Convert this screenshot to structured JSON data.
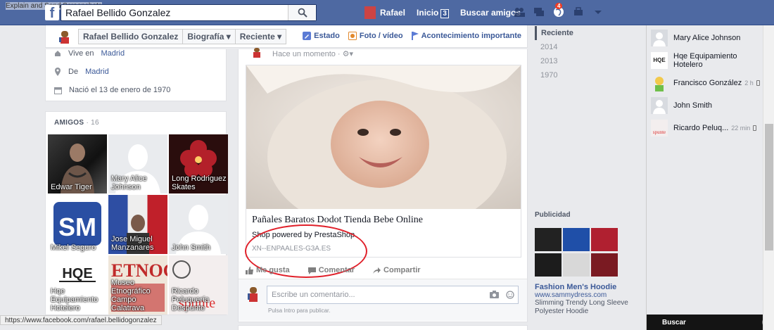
{
  "overlay": {
    "label": "Explain and Send Screenshots"
  },
  "search": {
    "value": "Rafael Bellido Gonzalez"
  },
  "nav": {
    "profile": "Rafael",
    "home": "Inicio",
    "home_count": "3",
    "find_friends": "Buscar amigos",
    "notif_count": "4"
  },
  "timeline_nav": {
    "crumbs": [
      "Rafael Bellido Gonzalez",
      "Biografía ▾",
      "Reciente ▾"
    ],
    "actions": [
      "Estado",
      "Foto / vídeo",
      "Acontecimiento importante"
    ]
  },
  "info": {
    "lives_prefix": "Vive en",
    "lives_place": "Madrid",
    "from_prefix": "De",
    "from_place": "Madrid",
    "born": "Nació el 13 de enero de 1970"
  },
  "friends": {
    "title": "AMIGOS",
    "count": "· 16",
    "items": [
      {
        "name": "Edwar Tiger"
      },
      {
        "name": "Mary Alice Johnson"
      },
      {
        "name": "Long Rodriguez Skates"
      },
      {
        "name": "Mikel Seguro"
      },
      {
        "name": "Jose Miguel Manzanares"
      },
      {
        "name": "John Smith"
      },
      {
        "name": "Hqe Equipamiento Hotelero"
      },
      {
        "name": "Museo Etnográfico Campo Calatrava"
      },
      {
        "name": "Ricardo Peluquería Despunte"
      }
    ]
  },
  "post": {
    "meta": "Hace un momento · ",
    "link_title": "Pañales Baratos Dodot Tienda Bebe Online",
    "link_desc": "Shop powered by PrestaShop",
    "link_domain": "XN--ENPAALES-G3A.ES",
    "like": "Me gusta",
    "comment": "Comentar",
    "share": "Compartir",
    "comment_placeholder": "Escribe un comentario...",
    "comment_hint": "Pulsa Intro para publicar."
  },
  "years": [
    "Reciente",
    "2014",
    "2013",
    "1970"
  ],
  "ad": {
    "title": "Publicidad",
    "name": "Fashion Men's Hoodie",
    "url": "www.sammydress.com",
    "desc": "Slimming Trendy Long Sleeve Polyester Hoodie",
    "colors": [
      "#222222",
      "#1f4fa8",
      "#b02030",
      "#1c1c1c",
      "#d8d8d8",
      "#7a1a22"
    ]
  },
  "chat": {
    "items": [
      {
        "name": "Mary Alice Johnson",
        "time": "",
        "mobile": false
      },
      {
        "name": "Hqe Equipamiento Hotelero",
        "time": "",
        "mobile": false
      },
      {
        "name": "Francisco González",
        "time": "2 h",
        "mobile": true
      },
      {
        "name": "John Smith",
        "time": "",
        "mobile": false
      },
      {
        "name": "Ricardo Peluq...",
        "time": "22 min",
        "mobile": true
      }
    ],
    "search": "Buscar"
  },
  "status_url": "https://www.facebook.com/rafael.bellidogonzalez"
}
